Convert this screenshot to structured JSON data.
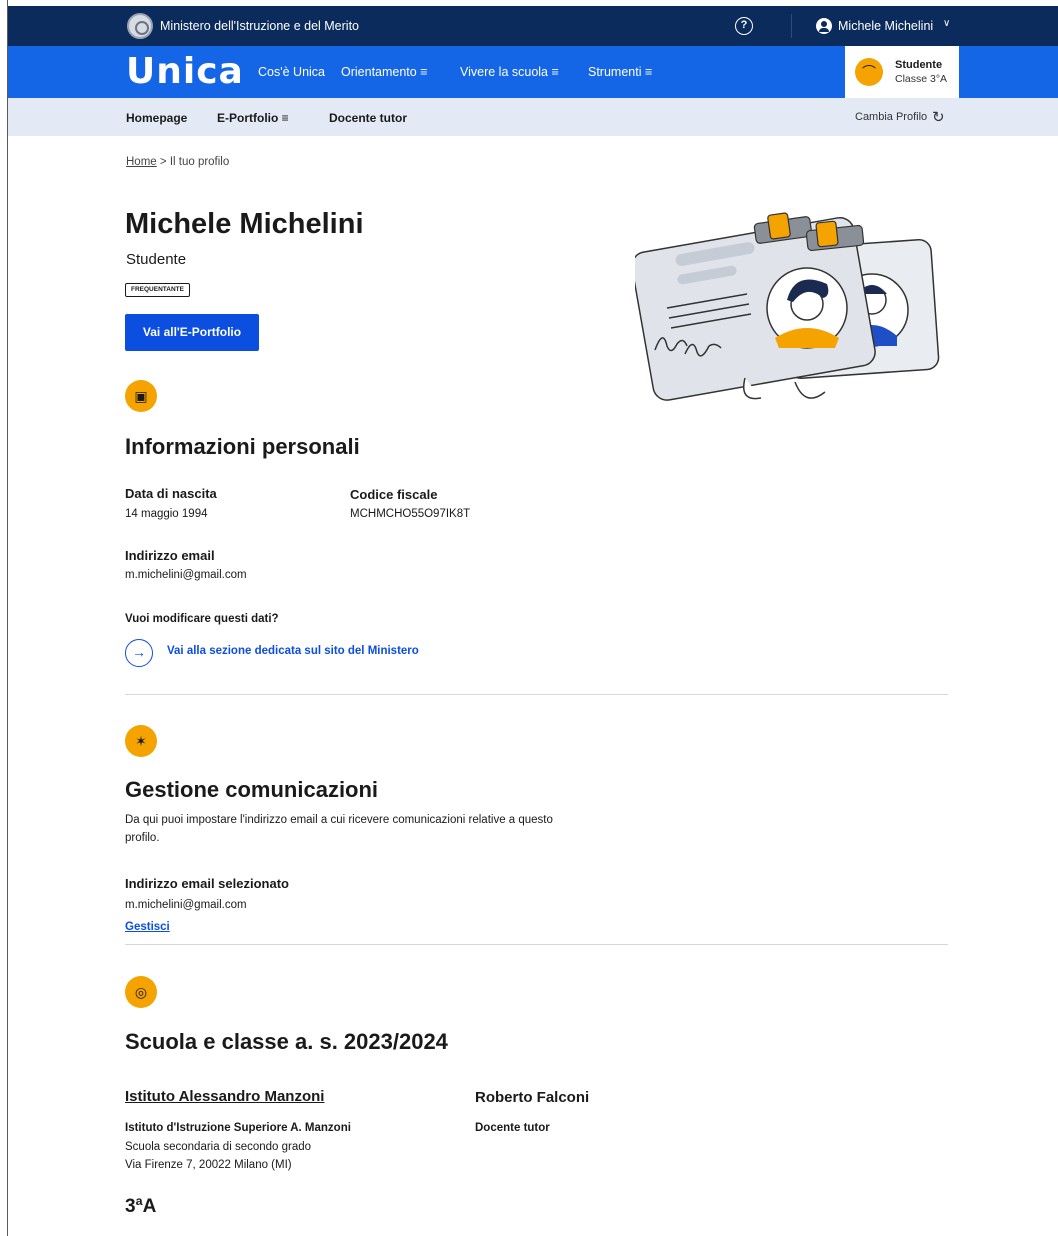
{
  "topbar": {
    "ministry": "Ministero dell'Istruzione e del Merito",
    "help_icon": "question-circle-icon",
    "user_name": "Michele Michelini"
  },
  "navbar": {
    "logo": "Unica",
    "items": [
      {
        "label": "Cos'è Unica"
      },
      {
        "label": "Orientamento ≡"
      },
      {
        "label": "Vivere la scuola ≡"
      },
      {
        "label": "Strumenti ≡"
      }
    ],
    "profile": {
      "role": "Studente",
      "class": "Classe 3°A"
    }
  },
  "subnav": {
    "items": [
      {
        "label": "Homepage"
      },
      {
        "label": "E-Portfolio ≡"
      },
      {
        "label": "Docente tutor"
      }
    ],
    "cambia_profilo": "Cambia Profilo"
  },
  "breadcrumb": {
    "home": "Home",
    "separator": ">",
    "current": "Il tuo profilo"
  },
  "profile": {
    "name": "Michele Michelini",
    "role": "Studente",
    "status_badge": "FREQUENTANTE",
    "eportfolio_button": "Vai all'E-Portfolio"
  },
  "personal_info": {
    "title": "Informazioni personali",
    "birth_label": "Data di nascita",
    "birth_value": "14 maggio 1994",
    "fiscal_label": "Codice fiscale",
    "fiscal_value": "MCHMCHO55O97IK8T",
    "email_label": "Indirizzo email",
    "email_value": "m.michelini@gmail.com",
    "modify_question": "Vuoi modificare questi dati?",
    "modify_link": "Vai alla sezione dedicata sul sito del Ministero"
  },
  "communications": {
    "title": "Gestione comunicazioni",
    "description_line1": "Da qui puoi impostare l'indirizzo email a cui ricevere comunicazioni relative a questo",
    "description_line2": "profilo.",
    "selected_label": "Indirizzo email selezionato",
    "selected_value": "m.michelini@gmail.com",
    "manage_link": "Gestisci"
  },
  "school": {
    "title": "Scuola e classe a. s. 2023/2024",
    "school_name": "Istituto Alessandro Manzoni",
    "school_full": "Istituto d'Istruzione Superiore A. Manzoni",
    "school_type": "Scuola secondaria di secondo grado",
    "school_address": "Via Firenze 7, 20022 Milano (MI)",
    "tutor_name": "Roberto Falconi",
    "tutor_role": "Docente tutor",
    "class": "3ªA"
  },
  "colors": {
    "dark_blue": "#0b2b5c",
    "brand_blue": "#1466e6",
    "link_blue": "#0b4ee0",
    "accent_yellow": "#f5a300",
    "subnav_bg": "#e3eaf5"
  }
}
